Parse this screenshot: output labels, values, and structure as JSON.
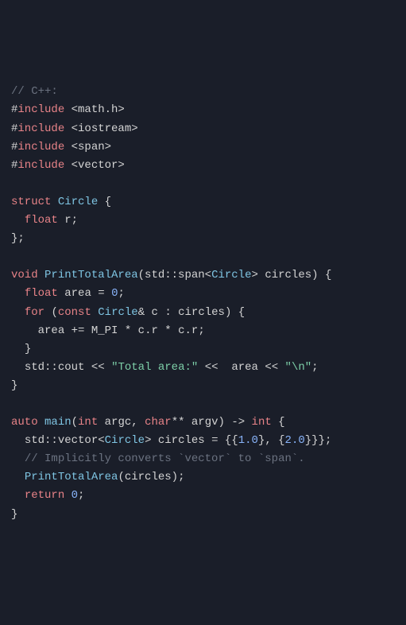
{
  "code": {
    "line1_comment": "// C++:",
    "hash": "#",
    "include_kw": "include",
    "inc_math": "<math.h>",
    "inc_iostream": "<iostream>",
    "inc_span": "<span>",
    "inc_vector": "<vector>",
    "struct_kw": "struct",
    "circle_name": "Circle",
    "float_kw": "float",
    "field_r": "r",
    "void_kw": "void",
    "fn_print": "PrintTotalArea",
    "std_span": "std::span",
    "lt": "<",
    "gt": ">",
    "param_circles": "circles",
    "area_var": "area",
    "zero": "0",
    "for_kw": "for",
    "const_kw": "const",
    "amp": "&",
    "c_var": "c",
    "colon": ":",
    "mpi": "M_PI",
    "dot_r": "c.r",
    "cout": "std::cout",
    "str_total": "\"Total area:\"",
    "stream_op": "<<",
    "str_nl": "\"\\n\"",
    "auto_kw": "auto",
    "main_fn": "main",
    "int_kw": "int",
    "argc": "argc",
    "char_kw": "char",
    "starstar": "**",
    "argv": "argv",
    "arrow": "->",
    "std_vector": "std::vector",
    "one_zero": "1.0",
    "two_zero": "2.0",
    "comment_impl": "// Implicitly converts `vector` to `span`.",
    "return_kw": "return",
    "semicolon": ";",
    "eq": "=",
    "pluseq": "+=",
    "star": "*",
    "comma": ",",
    "lbrace": "{",
    "rbrace": "}",
    "lparen": "(",
    "rparen": ")",
    "initlist_open": "{{",
    "initlist_mid": "}, {",
    "initlist_close": "}}};"
  }
}
